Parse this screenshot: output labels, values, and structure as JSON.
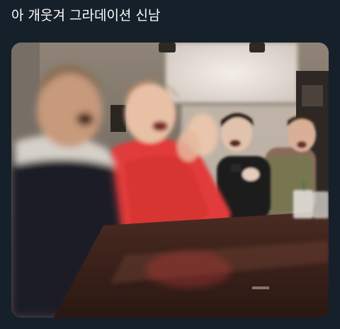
{
  "tweet": {
    "text": "아 개웃겨 그라데이션 신남"
  },
  "media": {
    "type": "photo",
    "subject": "photo-of-laughing-people-at-a-cafe-table"
  },
  "colors": {
    "background": "#15202b",
    "text": "#ffffff"
  }
}
